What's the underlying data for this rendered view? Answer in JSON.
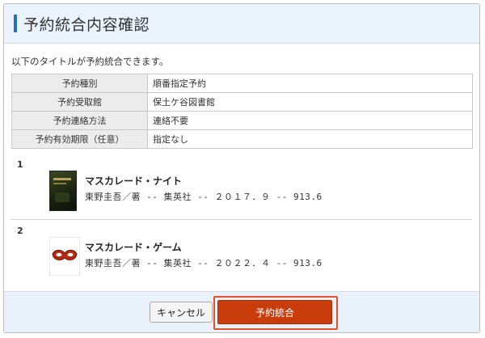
{
  "header": {
    "title": "予約統合内容確認"
  },
  "intro": "以下のタイトルが予約統合できます。",
  "info_rows": [
    {
      "label": "予約種別",
      "value": "順番指定予約"
    },
    {
      "label": "予約受取館",
      "value": "保土ケ谷図書館"
    },
    {
      "label": "予約連絡方法",
      "value": "連絡不要"
    },
    {
      "label": "予約有効期限（任意）",
      "value": "指定なし"
    }
  ],
  "items": [
    {
      "number": "1",
      "title": "マスカレード・ナイト",
      "meta": "東野圭吾／著 -- 集英社 -- ２０１７．９ -- 913.6",
      "icon": "book-cover-icon"
    },
    {
      "number": "2",
      "title": "マスカレード・ゲーム",
      "meta": "東野圭吾／著 -- 集英社 -- ２０２２．４ -- 913.6",
      "icon": "masquerade-mask-icon"
    }
  ],
  "buttons": {
    "cancel": "キャンセル",
    "merge": "予約統合"
  },
  "colors": {
    "accent_bar": "#2a6fb6",
    "merge_button": "#c93d0c",
    "highlight": "#e0512a",
    "header_bg": "#eaf3fb"
  }
}
